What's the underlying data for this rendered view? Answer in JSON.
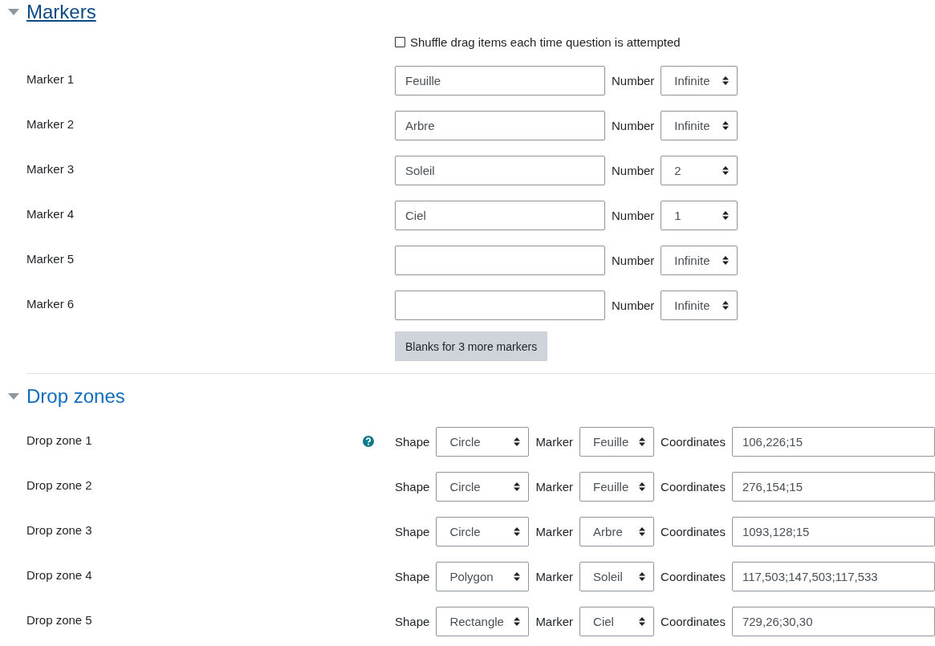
{
  "sections": [
    {
      "title": "Markers",
      "expanded": true,
      "focused": true,
      "kind": "markers",
      "shuffle": {
        "label": "Shuffle drag items each time question is attempted",
        "checked": false
      },
      "markers": [
        {
          "label": "Marker 1",
          "value": "Feuille",
          "number_label": "Number",
          "number": "Infinite"
        },
        {
          "label": "Marker 2",
          "value": "Arbre",
          "number_label": "Number",
          "number": "Infinite"
        },
        {
          "label": "Marker 3",
          "value": "Soleil",
          "number_label": "Number",
          "number": "2"
        },
        {
          "label": "Marker 4",
          "value": "Ciel",
          "number_label": "Number",
          "number": "1"
        },
        {
          "label": "Marker 5",
          "number_label": "Number",
          "number": "Infinite"
        },
        {
          "label": "Marker 6",
          "number_label": "Number",
          "number": "Infinite"
        }
      ],
      "button": "Blanks for 3 more markers"
    },
    {
      "title": "Drop zones",
      "expanded": true,
      "focused": false,
      "kind": "zones",
      "zones": [
        {
          "label": "Drop zone 1",
          "help": true,
          "shape_label": "Shape",
          "shape": "Circle",
          "marker_label": "Marker",
          "marker": "Feuille",
          "coords_label": "Coordinates",
          "coords": "106,226;15"
        },
        {
          "label": "Drop zone 2",
          "help": false,
          "shape_label": "Shape",
          "shape": "Circle",
          "marker_label": "Marker",
          "marker": "Feuille",
          "coords_label": "Coordinates",
          "coords": "276,154;15"
        },
        {
          "label": "Drop zone 3",
          "help": false,
          "shape_label": "Shape",
          "shape": "Circle",
          "marker_label": "Marker",
          "marker": "Arbre",
          "coords_label": "Coordinates",
          "coords": "1093,128;15"
        },
        {
          "label": "Drop zone 4",
          "help": false,
          "shape_label": "Shape",
          "shape": "Polygon",
          "marker_label": "Marker",
          "marker": "Soleil",
          "coords_label": "Coordinates",
          "coords": "117,503;147,503;117,533"
        },
        {
          "label": "Drop zone 5",
          "help": false,
          "shape_label": "Shape",
          "shape": "Rectangle",
          "marker_label": "Marker",
          "marker": "Ciel",
          "coords_label": "Coordinates",
          "coords": "729,26;30,30"
        }
      ]
    }
  ]
}
